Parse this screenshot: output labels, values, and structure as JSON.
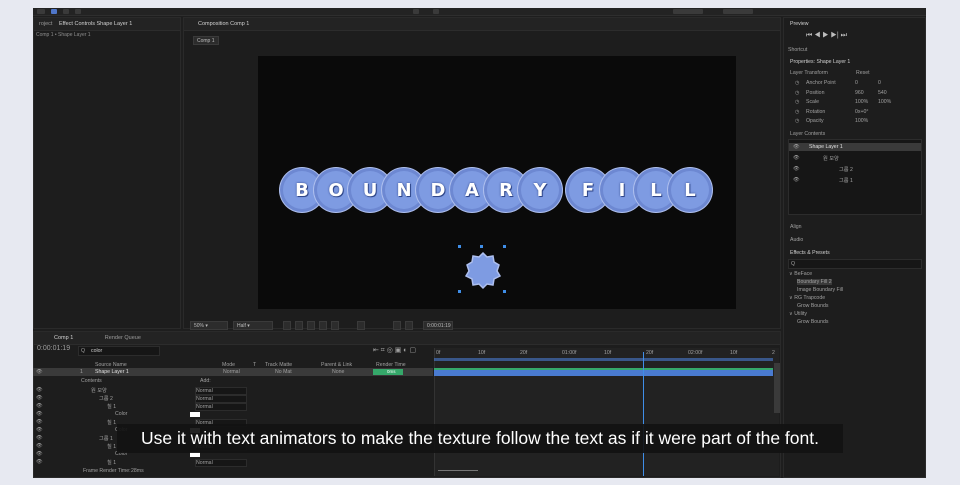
{
  "colors": {
    "accent": "#3f8ee8",
    "shape_fill": "#7e9be2",
    "shape_stroke": "#aebfee",
    "layer_bar": "#4a7bd1",
    "green_bar": "#35a86a"
  },
  "left_panel": {
    "tab_project": "roject",
    "tab_effect_controls": "Effect Controls Shape Layer 1",
    "breadcrumb": "Comp 1 • Shape Layer 1"
  },
  "composition": {
    "tab_label": "Composition Comp 1",
    "comp_button": "Comp 1",
    "words": [
      [
        "B",
        "O",
        "U",
        "N",
        "D",
        "A",
        "R",
        "Y"
      ],
      [
        "F",
        "I",
        "L",
        "L"
      ]
    ]
  },
  "viewer_bar": {
    "zoom": "50%",
    "resolution": "Half",
    "timecode": "0:00:01:19"
  },
  "right_panel": {
    "preview": "Preview",
    "shortcut": "Shortcut",
    "properties_title": "Properties: Shape Layer 1",
    "layer_transform": "Layer Transform",
    "reset": "Reset",
    "transform": [
      {
        "name": "Anchor Point",
        "v1": "0",
        "v2": "0"
      },
      {
        "name": "Position",
        "v1": "960",
        "v2": "540"
      },
      {
        "name": "Scale",
        "v1": "100%",
        "v2": "100%"
      },
      {
        "name": "Rotation",
        "v1": "0x+0°",
        "v2": ""
      },
      {
        "name": "Opacity",
        "v1": "100%",
        "v2": ""
      }
    ],
    "layer_contents": "Layer Contents",
    "contents": [
      "Shape Layer 1",
      "원 모양",
      "그룹 2",
      "그룹 1"
    ],
    "align": "Align",
    "audio": "Audio",
    "effects_presets": "Effects & Presets",
    "effects_search": "Q",
    "tree": [
      "∨ BeFace",
      "Boundary Fill 2",
      "Image Boundary Fill",
      "∨ RG Trapcode",
      "Grow Bounds",
      "∨ Utility",
      "Grow Bounds"
    ]
  },
  "timeline": {
    "tab_comp": "Comp 1",
    "tab_render": "Render Queue",
    "timecode": "0:00:01:19",
    "search": "color",
    "headers": [
      "Source Name",
      "Mode",
      "T",
      "Track Matte",
      "Parent & Link",
      "Render Time"
    ],
    "layer": {
      "num": "1",
      "name": "Shape Layer 1",
      "mode": "Normal",
      "matte": "No Mat",
      "parent": "None",
      "time": "0ms"
    },
    "contents_label": "Contents",
    "add": "Add:",
    "rows": [
      {
        "label": "원 모양",
        "mode": "Normal"
      },
      {
        "label": "그룹 2",
        "mode": "Normal"
      },
      {
        "label": "칠 1",
        "mode": "Normal"
      },
      {
        "label": "Color",
        "mode": ""
      },
      {
        "label": "칠 1",
        "mode": "Normal"
      },
      {
        "label": "Color",
        "mode": ""
      },
      {
        "label": "그룹 1",
        "mode": "Normal"
      },
      {
        "label": "칠 1",
        "mode": "Normal"
      },
      {
        "label": "Color",
        "mode": ""
      },
      {
        "label": "칠 1",
        "mode": "Normal"
      }
    ],
    "ruler": [
      "0f",
      "10f",
      "20f",
      "01:00f",
      "10f",
      "20f",
      "02:00f",
      "10f",
      "2"
    ],
    "frame_render_time": "Frame Render Time:",
    "frame_render_value": "28ms"
  },
  "caption": "Use it with text animators to make the texture follow the text as if it were part of the font."
}
